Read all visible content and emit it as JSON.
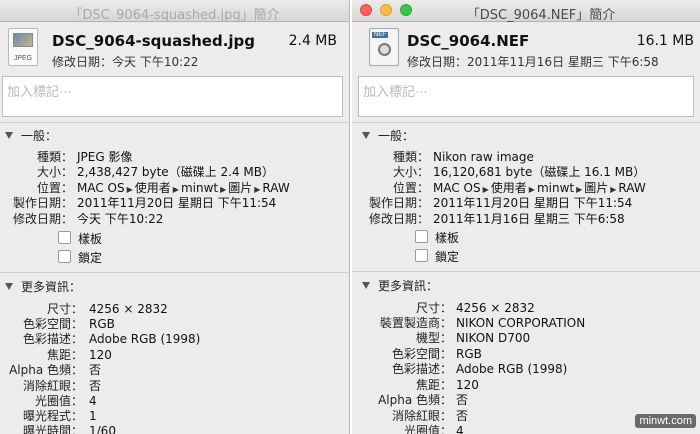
{
  "left": {
    "title": "「DSC_9064-squashed.jpg」簡介",
    "file_icon": "jpeg-file-icon",
    "file_icon_text": "JPEG",
    "filename": "DSC_9064-squashed.jpg",
    "size": "2.4 MB",
    "modified": "修改日期：今天 下午10:22",
    "tags_placeholder": "加入標記⋯",
    "general_header": "一般：",
    "general": [
      {
        "label": "種類：",
        "value": "JPEG 影像"
      },
      {
        "label": "大小：",
        "value": "2,438,427 byte（磁碟上 2.4 MB）"
      },
      {
        "label": "位置：",
        "path": [
          "MAC OS",
          "使用者",
          "minwt",
          "圖片",
          "RAW"
        ]
      },
      {
        "label": "製作日期：",
        "value": "2011年11月20日 星期日 下午11:54"
      },
      {
        "label": "修改日期：",
        "value": "今天 下午10:22"
      }
    ],
    "checkboxes": [
      "樣板",
      "鎖定"
    ],
    "more_header": "更多資訊：",
    "more": [
      {
        "label": "尺寸：",
        "value": "4256 × 2832"
      },
      {
        "label": "色彩空間：",
        "value": "RGB"
      },
      {
        "label": "色彩描述：",
        "value": "Adobe RGB (1998)"
      },
      {
        "label": "焦距：",
        "value": "120"
      },
      {
        "label": "Alpha 色頻：",
        "value": "否"
      },
      {
        "label": "消除紅眼：",
        "value": "否"
      },
      {
        "label": "光圈值：",
        "value": "4"
      },
      {
        "label": "曝光程式：",
        "value": "1"
      },
      {
        "label": "曝光時間：",
        "value": "1/60"
      }
    ]
  },
  "right": {
    "title": "「DSC_9064.NEF」簡介",
    "file_icon": "nef-raw-file-icon",
    "file_icon_text": "NEF",
    "filename": "DSC_9064.NEF",
    "size": "16.1 MB",
    "modified": "修改日期：2011年11月16日 星期三 下午6:58",
    "tags_placeholder": "加入標記⋯",
    "general_header": "一般：",
    "general": [
      {
        "label": "種類：",
        "value": "Nikon raw image"
      },
      {
        "label": "大小：",
        "value": "16,120,681 byte（磁碟上 16.1 MB）"
      },
      {
        "label": "位置：",
        "path": [
          "MAC OS",
          "使用者",
          "minwt",
          "圖片",
          "RAW"
        ]
      },
      {
        "label": "製作日期：",
        "value": "2011年11月20日 星期日 下午11:54"
      },
      {
        "label": "修改日期：",
        "value": "2011年11月16日 星期三 下午6:58"
      }
    ],
    "checkboxes": [
      "樣板",
      "鎖定"
    ],
    "more_header": "更多資訊：",
    "more": [
      {
        "label": "尺寸：",
        "value": "4256 × 2832"
      },
      {
        "label": "裝置製造商：",
        "value": "NIKON CORPORATION"
      },
      {
        "label": "機型：",
        "value": "NIKON D700"
      },
      {
        "label": "色彩空間：",
        "value": "RGB"
      },
      {
        "label": "色彩描述：",
        "value": "Adobe RGB (1998)"
      },
      {
        "label": "焦距：",
        "value": "120"
      },
      {
        "label": "Alpha 色頻：",
        "value": "否"
      },
      {
        "label": "消除紅眼：",
        "value": "否"
      },
      {
        "label": "光圈值：",
        "value": "4"
      }
    ]
  },
  "watermark": "minwt.com"
}
